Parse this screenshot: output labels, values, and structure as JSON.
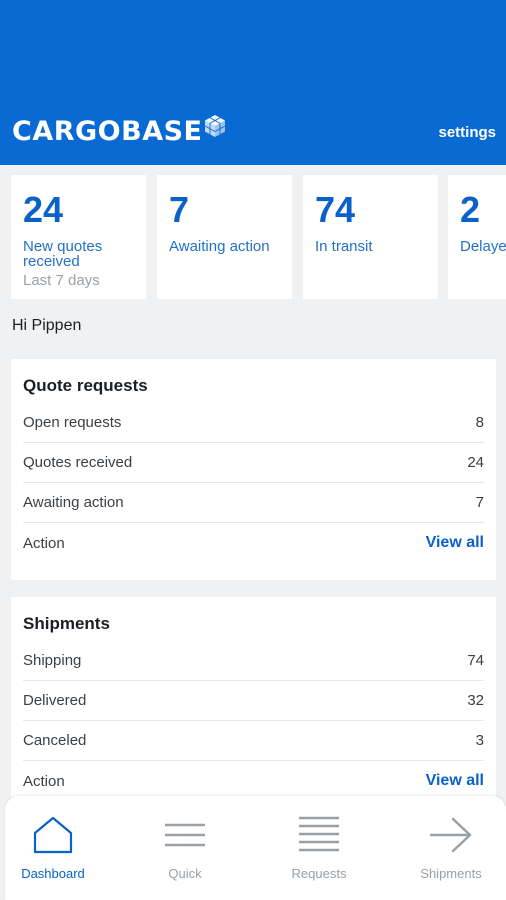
{
  "brand": {
    "logo_text": "CARGOBASE",
    "primary_color": "#0a6ad4",
    "accent_color": "#0a62c9"
  },
  "header": {
    "settings_label": "settings"
  },
  "stats": [
    {
      "value": "24",
      "label": "New quotes received",
      "sub": "Last 7 days"
    },
    {
      "value": "7",
      "label": "Awaiting action",
      "sub": ""
    },
    {
      "value": "74",
      "label": "In transit",
      "sub": ""
    },
    {
      "value": "2",
      "label": "Delayed",
      "sub": ""
    }
  ],
  "greeting": "Hi Pippen",
  "quote_requests": {
    "title": "Quote requests",
    "rows": [
      {
        "label": "Open requests",
        "value": "8"
      },
      {
        "label": "Quotes received",
        "value": "24"
      },
      {
        "label": "Awaiting action",
        "value": "7"
      }
    ],
    "action_label": "Action",
    "action_link": "View all"
  },
  "shipments": {
    "title": "Shipments",
    "rows": [
      {
        "label": "Shipping",
        "value": "74"
      },
      {
        "label": "Delivered",
        "value": "32"
      },
      {
        "label": "Canceled",
        "value": "3"
      }
    ],
    "action_label": "Action",
    "action_link": "View all"
  },
  "nav": {
    "items": [
      {
        "label": "Dashboard",
        "icon": "home-icon",
        "active": true
      },
      {
        "label": "Quick",
        "icon": "menu-lines-icon",
        "active": false
      },
      {
        "label": "Requests",
        "icon": "list-icon",
        "active": false
      },
      {
        "label": "Shipments",
        "icon": "arrow-right-icon",
        "active": false
      }
    ]
  }
}
